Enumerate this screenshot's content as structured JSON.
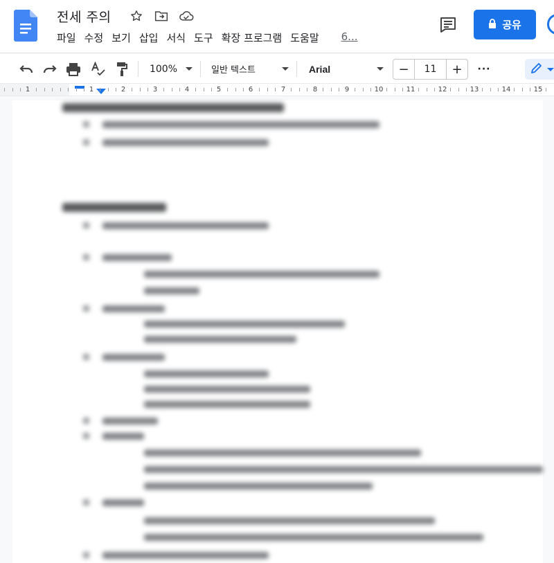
{
  "header": {
    "doc_title": "전세 주의",
    "title_icons": [
      "star-icon",
      "move-to-folder-icon",
      "cloud-status-icon"
    ],
    "menu": [
      "파일",
      "수정",
      "보기",
      "삽입",
      "서식",
      "도구",
      "확장 프로그램",
      "도움말"
    ],
    "menu_more": "6...",
    "share_label": "공유",
    "colors": {
      "brand_blue": "#1a73e8",
      "doc_icon_blue": "#4285f4"
    }
  },
  "toolbar": {
    "icons": [
      "undo-icon",
      "redo-icon",
      "print-icon",
      "spellcheck-icon",
      "paint-format-icon"
    ],
    "zoom": "100%",
    "style": "일반 텍스트",
    "font": "Arial",
    "font_size": "11",
    "decrease": "−",
    "increase": "+",
    "more": "···"
  },
  "ruler": {
    "numbers": [
      "1",
      "1",
      "2",
      "3",
      "4",
      "5",
      "6",
      "7",
      "8",
      "9",
      "10",
      "11",
      "12",
      "13",
      "14",
      "15"
    ]
  }
}
